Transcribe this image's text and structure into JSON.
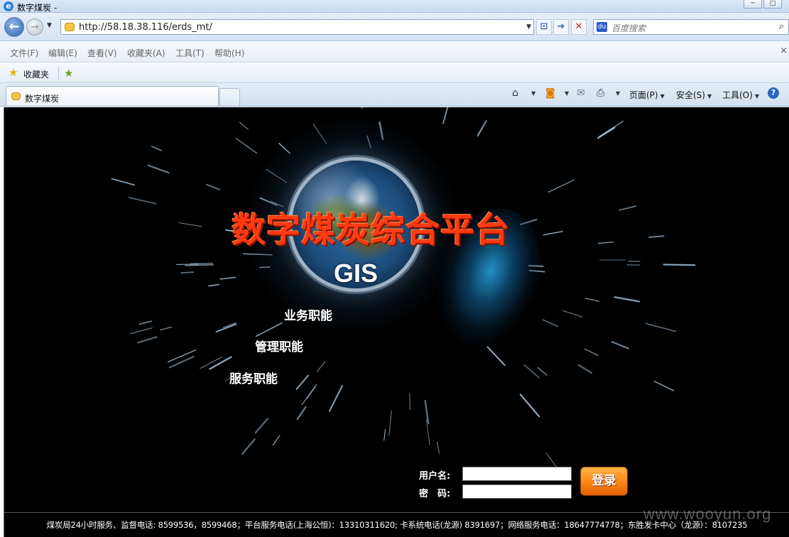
{
  "window": {
    "title": "数字煤炭 -",
    "controls": [
      "─",
      "□"
    ]
  },
  "address_bar": {
    "url": "http://58.18.38.116/erds_mt/",
    "search_placeholder": "百度搜索"
  },
  "menu": {
    "items": [
      "文件(F)",
      "编辑(E)",
      "查看(V)",
      "收藏夹(A)",
      "工具(T)",
      "帮助(H)"
    ]
  },
  "favorites": {
    "label": "收藏夹"
  },
  "tabs": {
    "active_label": "数字煤炭"
  },
  "command_bar": {
    "page": "页面(P)",
    "safety": "安全(S)",
    "tools": "工具(O)"
  },
  "page": {
    "title": "数字煤炭综合平台",
    "subtitle": "GIS",
    "functions": [
      "业务职能",
      "管理职能",
      "服务职能"
    ],
    "login": {
      "username_label": "用户名:",
      "password_label": "密　码:",
      "username_value": "",
      "password_value": "",
      "submit_label": "登录"
    },
    "footer": "煤炭局24小时服务、监督电话: 8599536，8599468；平台服务电话(上海公恒)：13310311620; 卡系统电话(龙源) 8391697；网络服务电话：18647774778；东胜发卡中心（龙源）：8107235",
    "watermark": "www.wooyun.org"
  },
  "colors": {
    "title_red": "#ff3a12",
    "login_orange": "#ff8a1a",
    "page_background": "#000000"
  }
}
